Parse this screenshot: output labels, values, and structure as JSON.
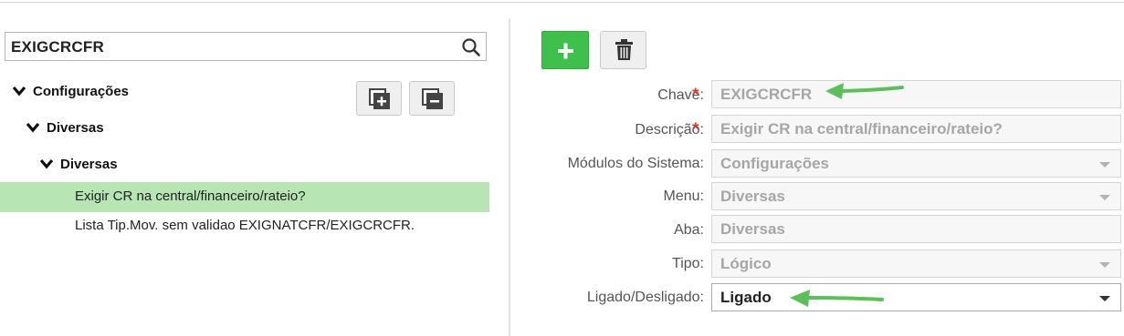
{
  "search": {
    "value": "EXIGCRCFR"
  },
  "tree": {
    "nodes": [
      {
        "label": "Configurações"
      },
      {
        "label": "Diversas"
      },
      {
        "label": "Diversas"
      }
    ],
    "leaves": [
      {
        "label": "Exigir CR na central/financeiro/rateio?",
        "selected": true
      },
      {
        "label": "Lista Tip.Mov. sem validao EXIGNATCFR/EXIGCRCFR."
      }
    ]
  },
  "form": {
    "chave": {
      "label": "Chave:",
      "value": "EXIGCRCFR",
      "required": "*"
    },
    "descricao": {
      "label": "Descrição:",
      "value": "Exigir CR na central/financeiro/rateio?",
      "required": "*"
    },
    "modulos": {
      "label": "Módulos do Sistema:",
      "value": "Configurações"
    },
    "menu": {
      "label": "Menu:",
      "value": "Diversas"
    },
    "aba": {
      "label": "Aba:",
      "value": "Diversas"
    },
    "tipo": {
      "label": "Tipo:",
      "value": "Lógico"
    },
    "ligado": {
      "label": "Ligado/Desligado:",
      "value": "Ligado"
    }
  },
  "colors": {
    "accent_green": "#3fbf4b",
    "selection": "#b7e5b4",
    "required": "#d43a2b",
    "annotation_arrow": "#5cc05a"
  },
  "icons": [
    "search-icon",
    "expand-all-icon",
    "collapse-all-icon",
    "plus-icon",
    "trash-icon",
    "chevron-down-icon",
    "caret-down-icon"
  ]
}
